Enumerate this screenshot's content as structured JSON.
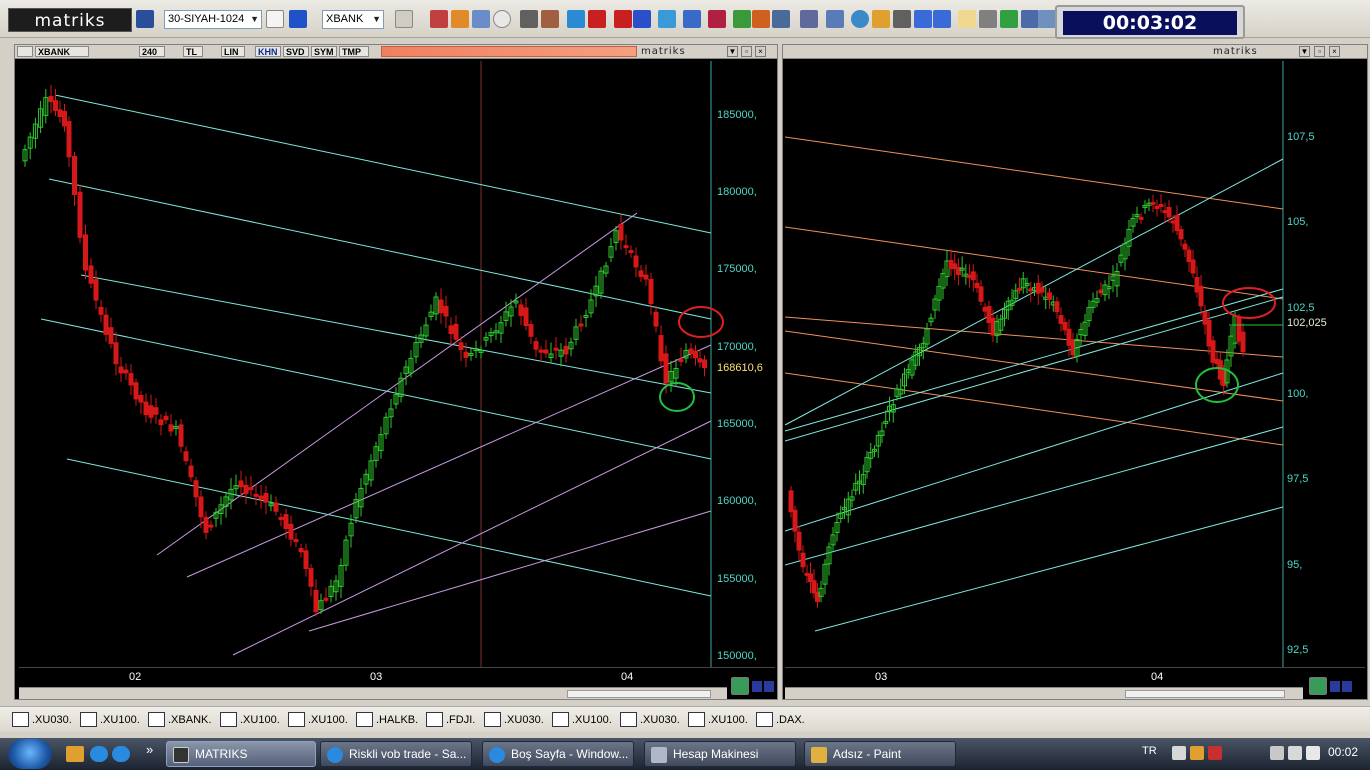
{
  "app": {
    "logo": "matriks",
    "clock": "00:03:02"
  },
  "toolbar": {
    "template_combo": "30-SIYAH-1024",
    "symbol_combo": "XBANK",
    "combo_arrow": "▼"
  },
  "left_chart": {
    "tabs": [
      {
        "label": "XBANK",
        "active": false
      },
      {
        "label": "240",
        "active": false
      },
      {
        "label": "TL",
        "active": false
      },
      {
        "label": "LIN",
        "active": false
      },
      {
        "label": "KHN",
        "active": true
      },
      {
        "label": "SVD",
        "active": false
      },
      {
        "label": "SYM",
        "active": false
      },
      {
        "label": "TMP",
        "active": false
      }
    ],
    "brand": "matriks",
    "price_axis": [
      "185000,",
      "180000,",
      "175000,",
      "170000,",
      "165000,",
      "160000,",
      "155000,",
      "150000,"
    ],
    "last_price": "168610,6",
    "dates": [
      "02",
      "03",
      "04"
    ]
  },
  "right_chart": {
    "brand": "matriks",
    "price_axis": [
      "107,5",
      "105,",
      "102,5",
      "100,",
      "97,5",
      "95,",
      "92,5"
    ],
    "last_price": "102,025",
    "dates": [
      "03",
      "04"
    ]
  },
  "window_buttons": {
    "minimize": "▼",
    "restore": "▫",
    "close": "×"
  },
  "instrument_tabs": [
    ".XU030.",
    ".XU100.",
    ".XBANK.",
    ".XU100.",
    ".XU100.",
    ".HALKB.",
    ".FDJI.",
    ".XU030.",
    ".XU100.",
    ".XU030.",
    ".XU100.",
    ".DAX."
  ],
  "taskbar": {
    "quick_launch_more": "»",
    "tasks": [
      {
        "label": "MATRIKS",
        "active": true
      },
      {
        "label": "Riskli vob trade - Sa...",
        "active": false
      },
      {
        "label": "Boş Sayfa - Window...",
        "active": false
      },
      {
        "label": "Hesap Makinesi",
        "active": false
      },
      {
        "label": "Adsız - Paint",
        "active": false
      }
    ],
    "language": "TR",
    "time": "00:02"
  },
  "colors": {
    "bull_candle": "#2ec82e",
    "bear_candle": "#d61818",
    "axis_text": "#4fd6c8",
    "cyan_channel": "#7fe8e0",
    "pink_channel": "#c89ae0",
    "orange_channel": "#f0905a",
    "highlight_red": "#e02020",
    "highlight_green": "#20c040"
  }
}
